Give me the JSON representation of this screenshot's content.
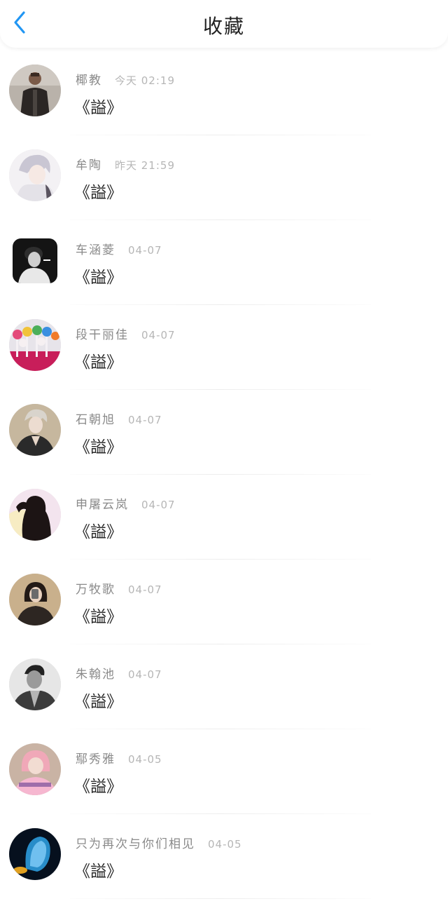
{
  "header": {
    "title": "收藏"
  },
  "colors": {
    "accent": "#2196f3",
    "name": "#8a8a8a",
    "time": "#b6b6b6"
  },
  "items": [
    {
      "name": "椰教",
      "time": "今天 02:19",
      "content": "《謚》",
      "avatar": "man-leather-jacket"
    },
    {
      "name": "牟陶",
      "time": "昨天 21:59",
      "content": "《謚》",
      "avatar": "anime-white-hair"
    },
    {
      "name": "车涵菱",
      "time": "04-07",
      "content": "《謚》",
      "avatar": "bw-portrait-smoking"
    },
    {
      "name": "段干丽佳",
      "time": "04-07",
      "content": "《謚》",
      "avatar": "cake-pops"
    },
    {
      "name": "石朝旭",
      "time": "04-07",
      "content": "《謚》",
      "avatar": "anime-dark-outfit"
    },
    {
      "name": "申屠云岚",
      "time": "04-07",
      "content": "《謚》",
      "avatar": "silhouette-woman"
    },
    {
      "name": "万牧歌",
      "time": "04-07",
      "content": "《謚》",
      "avatar": "girl-selfie"
    },
    {
      "name": "朱翰池",
      "time": "04-07",
      "content": "《謚》",
      "avatar": "bw-man-portrait"
    },
    {
      "name": "鄢秀雅",
      "time": "04-05",
      "content": "《謚》",
      "avatar": "pink-hair-girl"
    },
    {
      "name": "只为再次与你们相见",
      "time": "04-05",
      "content": "《謚》",
      "avatar": "jellyfish"
    }
  ]
}
